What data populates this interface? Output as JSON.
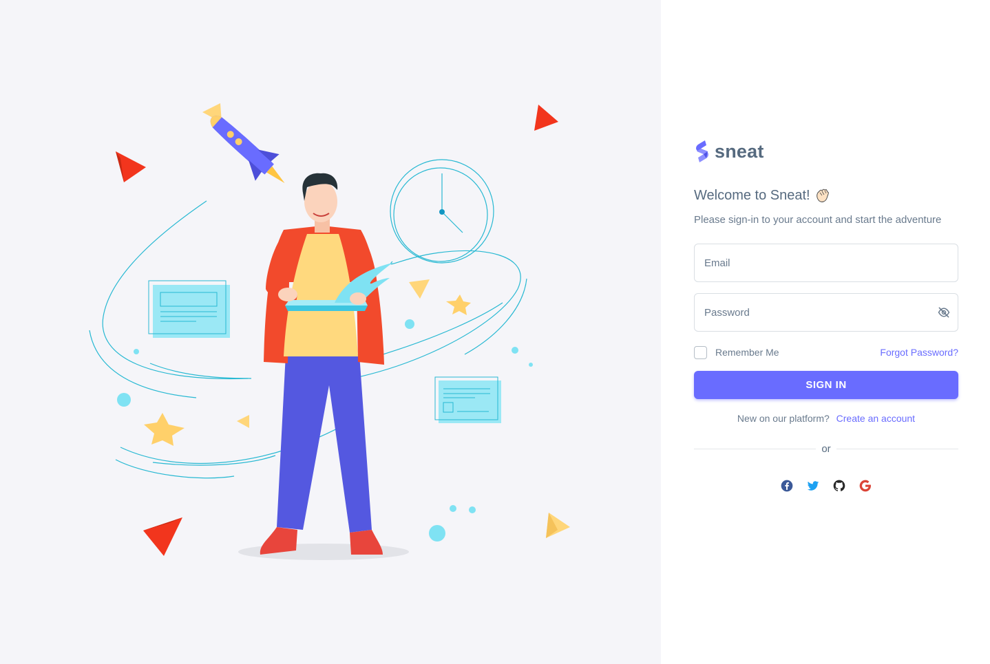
{
  "brand": {
    "name": "sneat",
    "logo_icon": "sneat-logo-icon"
  },
  "welcome": {
    "title": "Welcome to Sneat!",
    "emoji_icon": "waving-hand-icon",
    "subtitle": "Please sign-in to your account and start the adventure"
  },
  "form": {
    "email_placeholder": "Email",
    "password_placeholder": "Password",
    "password_toggle_icon": "eye-off-icon",
    "remember_label": "Remember Me",
    "forgot_label": "Forgot Password?",
    "signin_label": "SIGN IN"
  },
  "register": {
    "prompt": "New on our platform?",
    "link_label": "Create an account"
  },
  "divider": {
    "text": "or"
  },
  "socials": [
    {
      "name": "facebook",
      "icon": "facebook-icon",
      "color": "#3b5998"
    },
    {
      "name": "twitter",
      "icon": "twitter-icon",
      "color": "#1da1f2"
    },
    {
      "name": "github",
      "icon": "github-icon",
      "color": "#272727"
    },
    {
      "name": "google",
      "icon": "google-icon",
      "color": "#db4437"
    }
  ],
  "colors": {
    "primary": "#696cff",
    "text": "#566a7f",
    "muted": "#697a8d",
    "left_bg": "#f5f5f9"
  }
}
